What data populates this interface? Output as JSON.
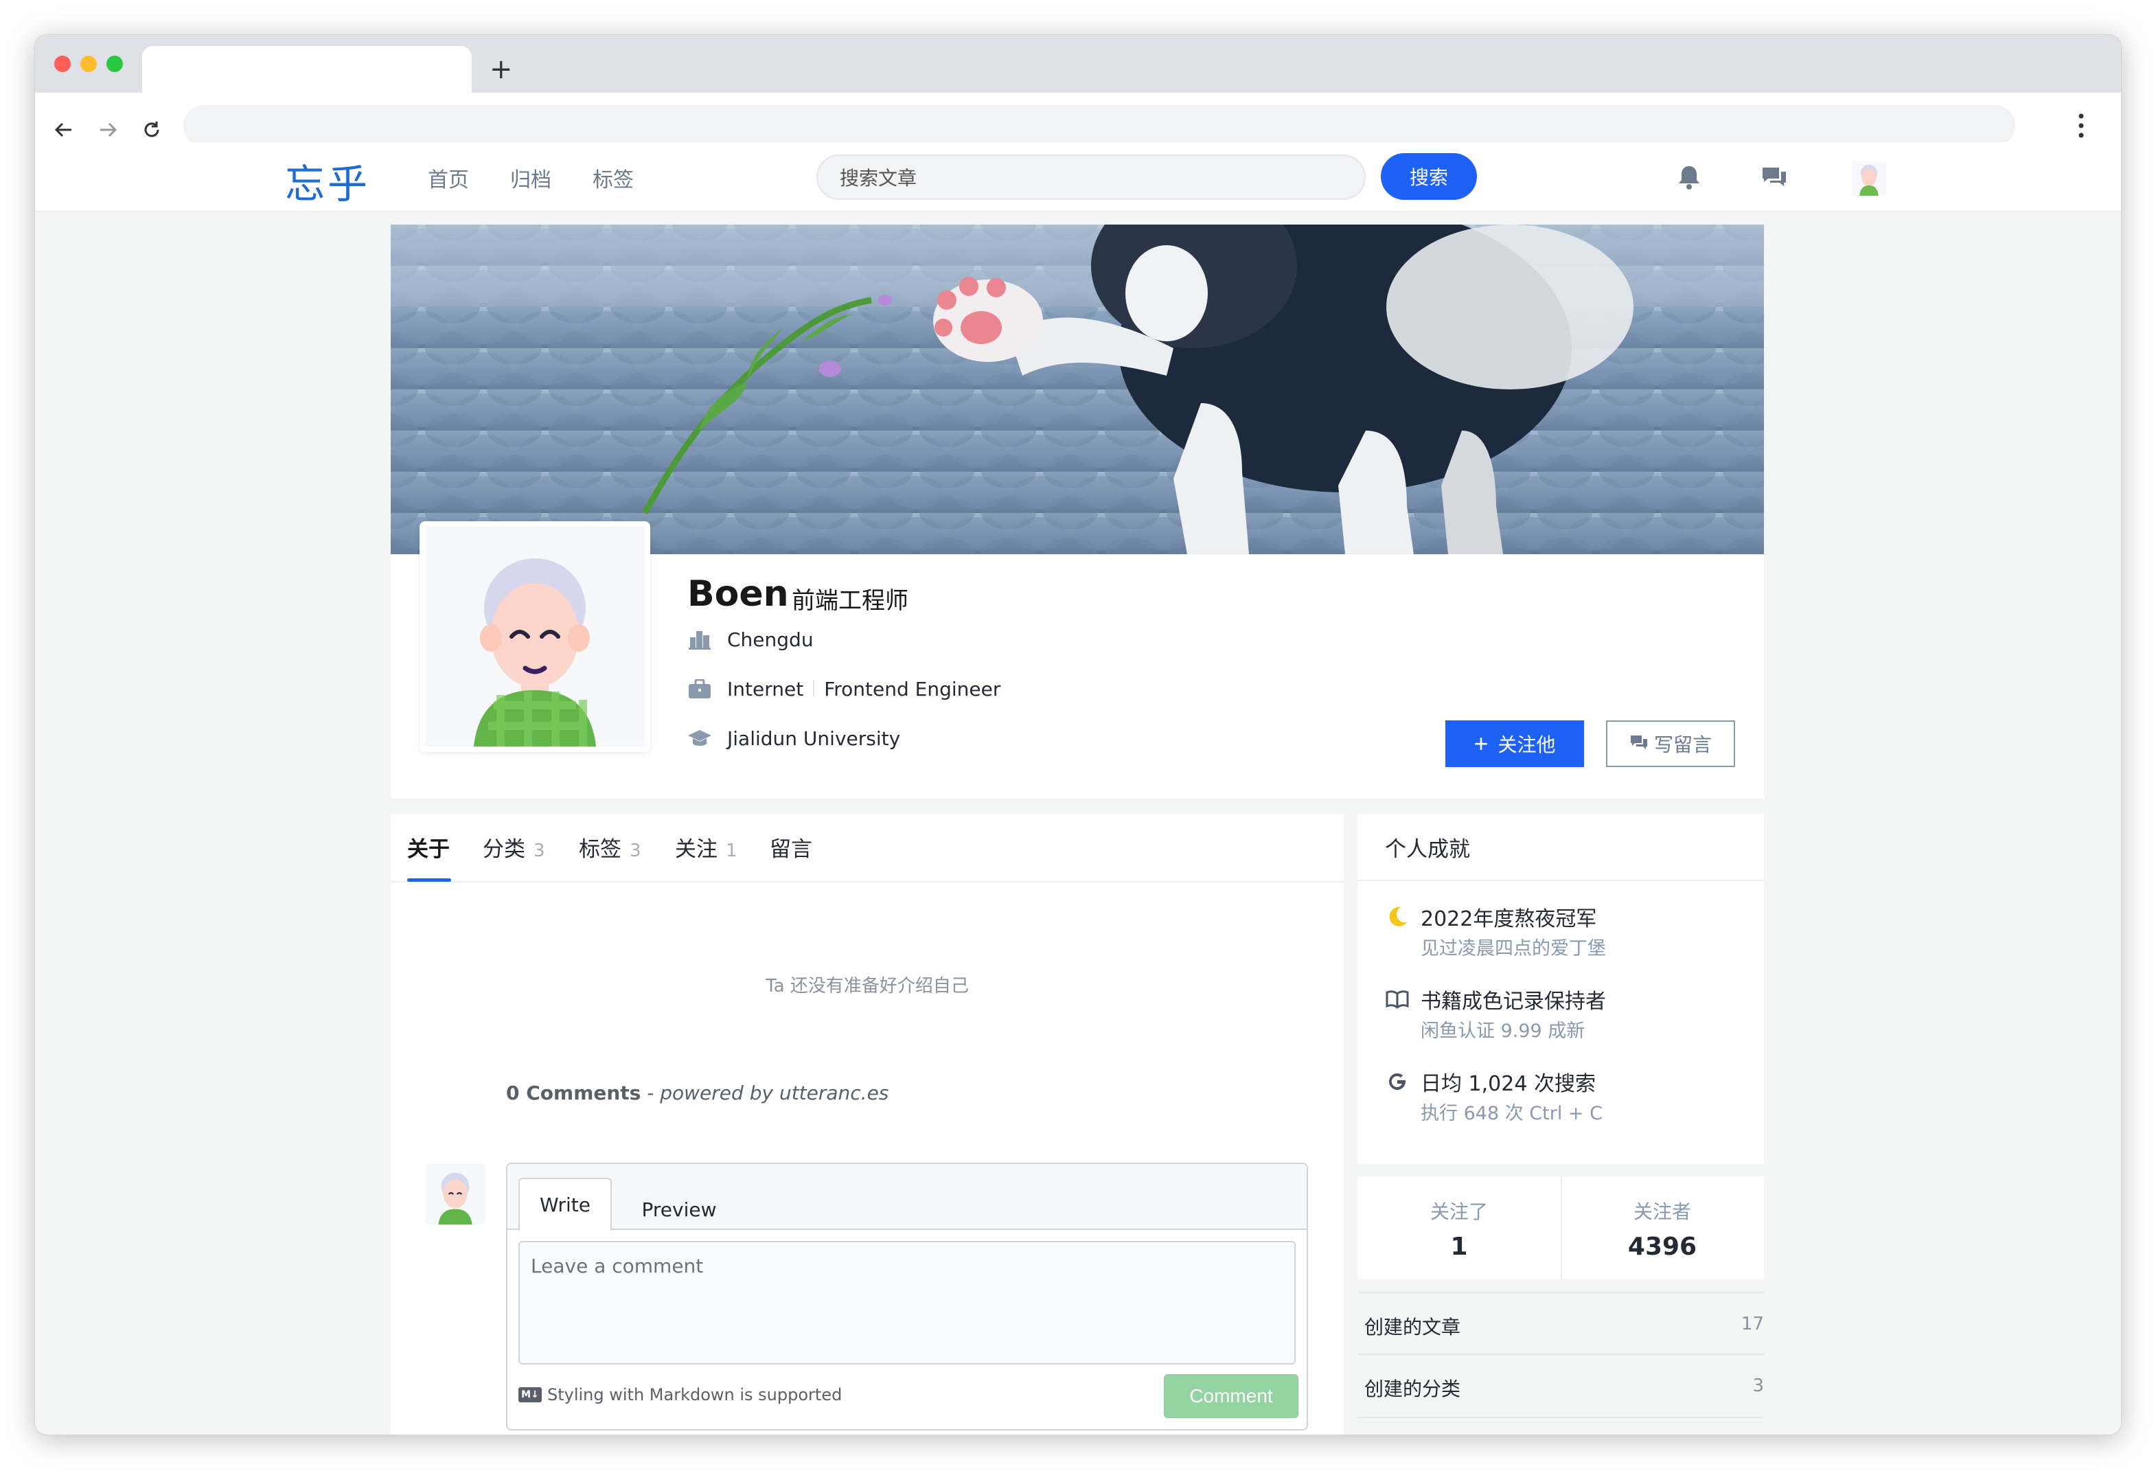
{
  "browser": {
    "new_tab_label": "+",
    "back_icon": "arrow-left-icon",
    "forward_icon": "arrow-right-icon",
    "reload_icon": "reload-icon",
    "menu_icon": "kebab-menu-icon",
    "url": ""
  },
  "site": {
    "logo": "忘乎",
    "nav": [
      "首页",
      "归档",
      "标签"
    ],
    "search_placeholder": "搜索文章",
    "search_button": "搜索",
    "accent_color": "#1e62f5"
  },
  "profile": {
    "name": "Boen",
    "title": "前端工程师",
    "city": "Chengdu",
    "industry": "Internet",
    "job": "Frontend Engineer",
    "school": "Jialidun University",
    "follow_button": "关注他",
    "message_button": "写留言"
  },
  "tabs": [
    {
      "label": "关于",
      "count": ""
    },
    {
      "label": "分类",
      "count": "3"
    },
    {
      "label": "标签",
      "count": "3"
    },
    {
      "label": "关注",
      "count": "1"
    },
    {
      "label": "留言",
      "count": ""
    }
  ],
  "about": {
    "empty_text": "Ta 还没有准备好介绍自己"
  },
  "comments": {
    "count_text": "0 Comments",
    "powered_by": "- powered by utteranc.es",
    "tab_write": "Write",
    "tab_preview": "Preview",
    "placeholder": "Leave a comment",
    "markdown_badge": "M↓",
    "markdown_hint": "Styling with Markdown is supported",
    "submit": "Comment"
  },
  "achievements": {
    "title": "个人成就",
    "items": [
      {
        "icon": "moon-icon",
        "title": "2022年度熬夜冠军",
        "sub": "见过凌晨四点的爱丁堡"
      },
      {
        "icon": "book-icon",
        "title": "书籍成色记录保持者",
        "sub": "闲鱼认证 9.99 成新"
      },
      {
        "icon": "google-icon",
        "title": "日均 1,024 次搜索",
        "sub": "执行 648 次 Ctrl + C"
      }
    ]
  },
  "follow_stats": {
    "following_label": "关注了",
    "following": "1",
    "followers_label": "关注者",
    "followers": "4396"
  },
  "stats": [
    {
      "label": "创建的文章",
      "value": "17"
    },
    {
      "label": "创建的分类",
      "value": "3"
    }
  ]
}
